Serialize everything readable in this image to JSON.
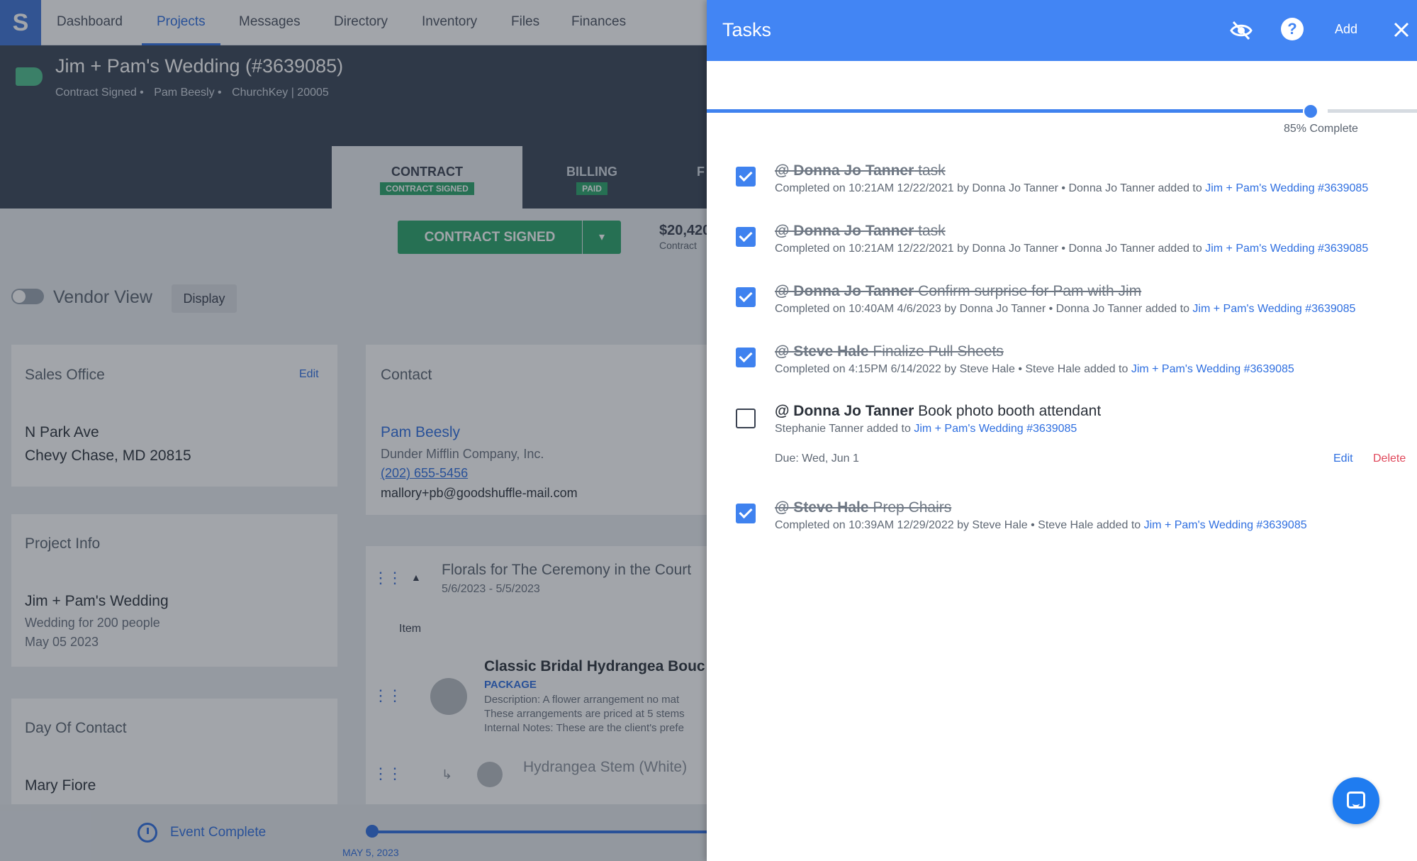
{
  "colors": {
    "brand_blue": "#4285f4",
    "link_blue": "#2f6fe0",
    "success_green": "#2aa46a",
    "delete_red": "#e0475a"
  },
  "nav": {
    "logo": "S",
    "items": [
      "Dashboard",
      "Projects",
      "Messages",
      "Directory",
      "Inventory",
      "Files",
      "Finances"
    ],
    "active": "Projects"
  },
  "project": {
    "title": "Jim + Pam's Wedding (#3639085)",
    "meta": [
      "Contract Signed •",
      "Pam Beesly •",
      "ChurchKey | 20005"
    ],
    "tabs": [
      {
        "label": "CONTRACT",
        "badge": "CONTRACT SIGNED"
      },
      {
        "label": "BILLING",
        "badge": "PAID"
      },
      {
        "label": "F",
        "badge": ""
      }
    ],
    "status_button": "CONTRACT SIGNED",
    "amount": "$20,420",
    "amount_sub": "Contract"
  },
  "view": {
    "vendor_view_label": "Vendor View",
    "display_button": "Display"
  },
  "sales_office": {
    "title": "Sales Office",
    "edit": "Edit",
    "address1": "N Park Ave",
    "address2": "Chevy Chase, MD 20815"
  },
  "contact": {
    "title": "Contact",
    "name": "Pam Beesly",
    "company": "Dunder Mifflin Company, Inc.",
    "phone": "(202) 655-5456",
    "email": "mallory+pb@goodshuffle-mail.com"
  },
  "project_info": {
    "title": "Project Info",
    "name": "Jim + Pam's Wedding",
    "desc": "Wedding for 200 people",
    "date": "May 05 2023"
  },
  "day_of_contact": {
    "title": "Day Of Contact",
    "name": "Mary Fiore"
  },
  "line_items": {
    "section_title": "Florals for The Ceremony in the Court",
    "section_dates": "5/6/2023 - 5/5/2023",
    "col_item": "Item",
    "item1_name": "Classic Bridal Hydrangea Bouc",
    "item1_type": "PACKAGE",
    "item1_desc1": "Description: A flower arrangement no mat",
    "item1_desc2": "These arrangements are priced at 5 stems",
    "item1_desc3": "Internal Notes: These are the client's prefe",
    "item2_name": "Hydrangea Stem (White)"
  },
  "bottom": {
    "event_label": "Event Complete",
    "date": "MAY 5, 2023"
  },
  "tasks_panel": {
    "title": "Tasks",
    "add_label": "Add",
    "progress_fraction": 0.85,
    "progress_label": "85% Complete",
    "tasks": [
      {
        "assignee": "@ Donna Jo Tanner",
        "text": " task",
        "done": true,
        "meta": "Completed on 10:21AM 12/22/2021 by Donna Jo Tanner • Donna Jo Tanner added to ",
        "link": "Jim + Pam's Wedding #3639085"
      },
      {
        "assignee": "@ Donna Jo Tanner",
        "text": " task",
        "done": true,
        "meta": "Completed on 10:21AM 12/22/2021 by Donna Jo Tanner • Donna Jo Tanner added to ",
        "link": "Jim + Pam's Wedding #3639085"
      },
      {
        "assignee": "@ Donna Jo Tanner",
        "text": " Confirm surprise for Pam with Jim",
        "done": true,
        "meta": "Completed on 10:40AM 4/6/2023 by Donna Jo Tanner • Donna Jo Tanner added to ",
        "link": "Jim + Pam's Wedding #3639085"
      },
      {
        "assignee": "@ Steve Hale",
        "text": " Finalize Pull Sheets",
        "done": true,
        "meta": "Completed on 4:15PM 6/14/2022 by Steve Hale • Steve Hale added to ",
        "link": "Jim + Pam's Wedding #3639085"
      },
      {
        "assignee": "@ Donna Jo Tanner",
        "text": " Book photo booth attendant",
        "done": false,
        "meta": "Stephanie Tanner added to ",
        "link": "Jim + Pam's Wedding #3639085",
        "due": "Due: Wed, Jun 1",
        "edit": "Edit",
        "delete": "Delete"
      },
      {
        "assignee": "@ Steve Hale",
        "text": " Prep Chairs",
        "done": true,
        "meta": "Completed on 10:39AM 12/29/2022 by Steve Hale • Steve Hale added to ",
        "link": "Jim + Pam's Wedding #3639085"
      }
    ]
  }
}
